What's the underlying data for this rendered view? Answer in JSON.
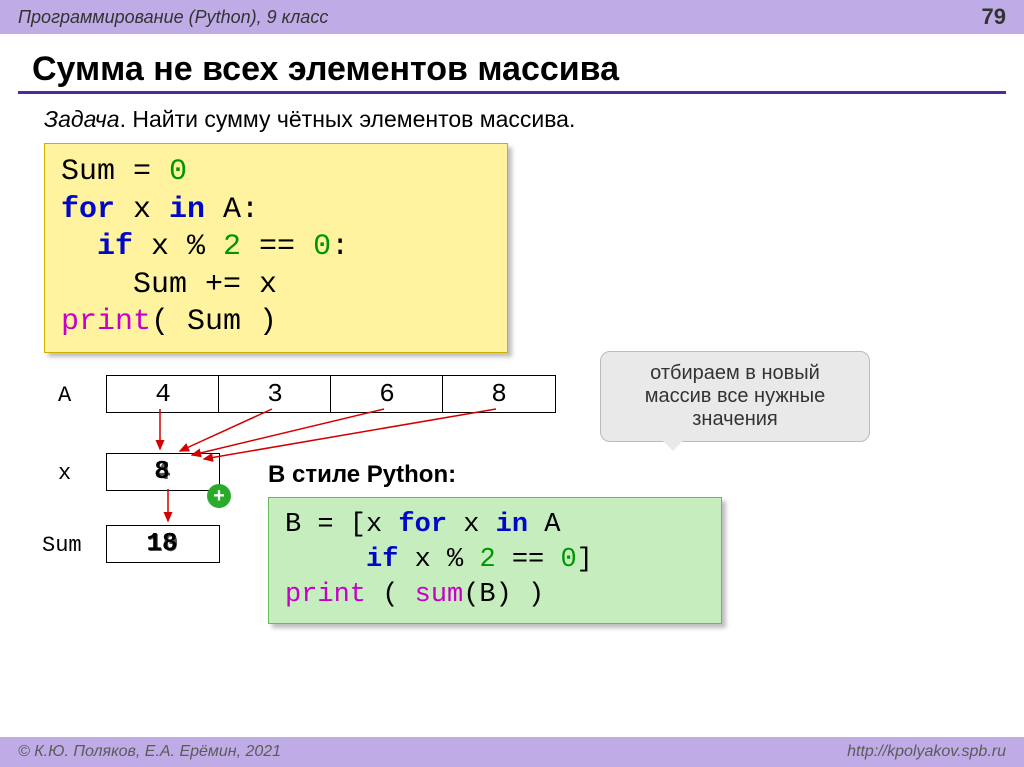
{
  "header": {
    "course": "Программирование (Python), 9 класс",
    "page": "79"
  },
  "title": "Сумма не всех элементов массива",
  "task": {
    "label": "Задача",
    "text": ". Найти сумму чётных элементов массива."
  },
  "code1": {
    "l1a": "Sum = ",
    "l1b": "0",
    "l2a": "for",
    "l2b": " x ",
    "l2c": "in",
    "l2d": " A:",
    "l3a": "  if",
    "l3b": " x % ",
    "l3c": "2",
    "l3d": " == ",
    "l3e": "0",
    "l3f": ":",
    "l4": "    Sum += x",
    "l5a": "print",
    "l5b": "( Sum )"
  },
  "diagram": {
    "A": "A",
    "x": "x",
    "Sum": "Sum",
    "cells": [
      "4",
      "3",
      "6",
      "8"
    ],
    "xbox": "8",
    "xbox_behind": "4",
    "sumbox": "18",
    "sumbox_behind": "10"
  },
  "callout": "отбираем в новый массив все нужные значения",
  "sublabel": "В стиле Python:",
  "code2": {
    "l1a": "B = [x ",
    "l1b": "for",
    "l1c": " x ",
    "l1d": "in",
    "l1e": " A",
    "l2a": "     if",
    "l2b": " x % ",
    "l2c": "2",
    "l2d": " == ",
    "l2e": "0",
    "l2f": "]",
    "l3a": "print",
    "l3b": " ( ",
    "l3c": "sum",
    "l3d": "(B) )"
  },
  "footer": {
    "left": "© К.Ю. Поляков, Е.А. Ерёмин, 2021",
    "right": "http://kpolyakov.spb.ru"
  }
}
